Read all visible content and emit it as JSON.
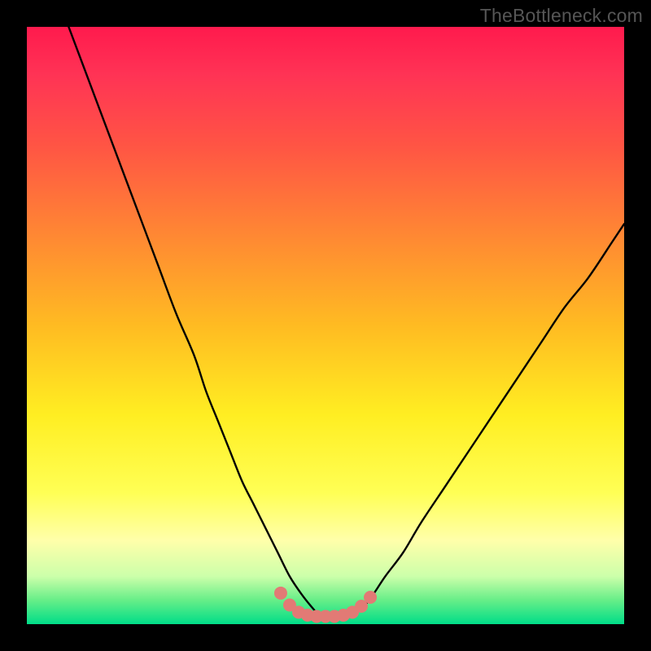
{
  "watermark": "TheBottleneck.com",
  "chart_data": {
    "type": "line",
    "title": "",
    "xlabel": "",
    "ylabel": "",
    "xlim": [
      0,
      100
    ],
    "ylim": [
      0,
      100
    ],
    "series": [
      {
        "name": "curve",
        "x": [
          7,
          10,
          13,
          16,
          19,
          22,
          25,
          28,
          30,
          32,
          34,
          36,
          38,
          40,
          42,
          44,
          46,
          48,
          49,
          50,
          52,
          54,
          56,
          58,
          60,
          63,
          66,
          70,
          74,
          78,
          82,
          86,
          90,
          94,
          98,
          100
        ],
        "y": [
          100,
          92,
          84,
          76,
          68,
          60,
          52,
          45,
          39,
          34,
          29,
          24,
          20,
          16,
          12,
          8,
          5,
          2.5,
          1.5,
          1.3,
          1.3,
          1.5,
          2.5,
          5,
          8,
          12,
          17,
          23,
          29,
          35,
          41,
          47,
          53,
          58,
          64,
          67
        ]
      },
      {
        "name": "marker-band",
        "x_range": [
          42,
          58
        ],
        "y_range": [
          1.2,
          6
        ],
        "color": "#e27a75",
        "points": [
          {
            "x": 42.5,
            "y": 5.2
          },
          {
            "x": 44.0,
            "y": 3.2
          },
          {
            "x": 45.5,
            "y": 2.0
          },
          {
            "x": 47.0,
            "y": 1.5
          },
          {
            "x": 48.5,
            "y": 1.3
          },
          {
            "x": 50.0,
            "y": 1.3
          },
          {
            "x": 51.5,
            "y": 1.3
          },
          {
            "x": 53.0,
            "y": 1.5
          },
          {
            "x": 54.5,
            "y": 2.0
          },
          {
            "x": 56.0,
            "y": 3.0
          },
          {
            "x": 57.5,
            "y": 4.5
          }
        ]
      }
    ],
    "background_gradient": {
      "top": "#ff1a4d",
      "bottom": "#00dd88"
    }
  }
}
